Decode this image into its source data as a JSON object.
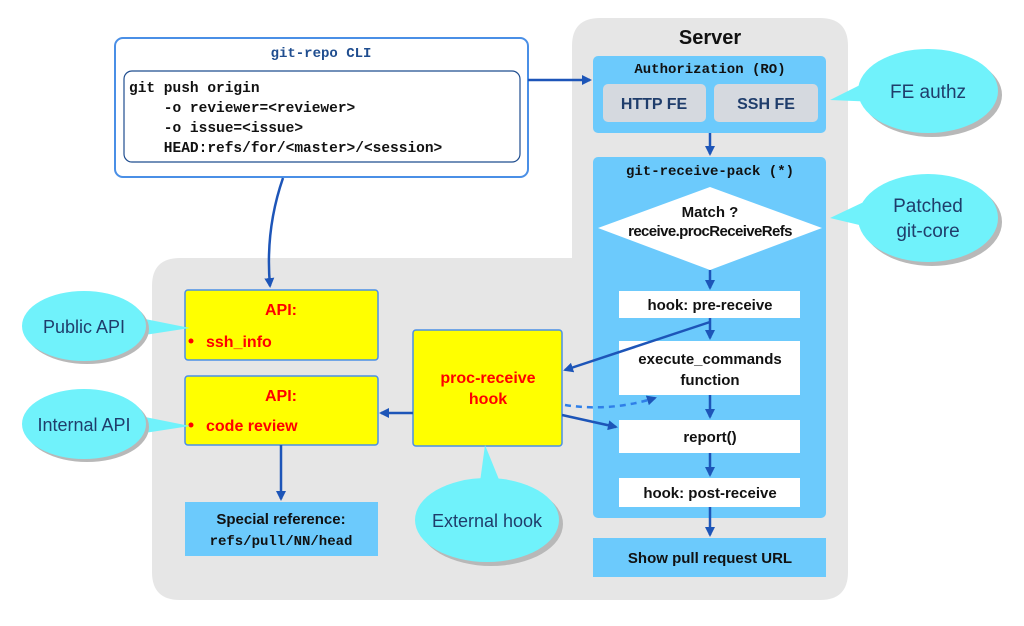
{
  "server": {
    "title": "Server"
  },
  "cli": {
    "title": "git-repo CLI",
    "lines": [
      "git push origin",
      "    -o reviewer=<reviewer>",
      "    -o issue=<issue>",
      "    HEAD:refs/for/<master>/<session>"
    ]
  },
  "authorization": {
    "title": "Authorization (RO)",
    "http": "HTTP FE",
    "ssh": "SSH FE"
  },
  "receive_pack": {
    "title": "git-receive-pack (*)",
    "decision_line1": "Match ?",
    "decision_line2": "receive.procReceiveRefs",
    "pre_receive": "hook: pre-receive",
    "execute_line1": "execute_commands",
    "execute_line2": "function",
    "report": "report()",
    "post_receive": "hook: post-receive"
  },
  "show_url": "Show pull request URL",
  "api_public": {
    "title": "API:",
    "item": "ssh_info"
  },
  "api_internal": {
    "title": "API:",
    "item": "code review"
  },
  "proc_receive": {
    "line1": "proc-receive",
    "line2": "hook"
  },
  "special_ref": {
    "line1": "Special reference:",
    "line2": "refs/pull/NN/head"
  },
  "callouts": {
    "fe_authz": "FE authz",
    "patched_line1": "Patched",
    "patched_line2": "git-core",
    "public_api": "Public API",
    "internal_api": "Internal API",
    "external_hook": "External hook"
  },
  "colors": {
    "box_blue": "#6ccafc",
    "callout": "#70f2fb",
    "api_yellow": "#ffff00",
    "arrow": "#1d55b8",
    "api_red": "#ff0000",
    "server_bg": "#e6e6e6"
  }
}
